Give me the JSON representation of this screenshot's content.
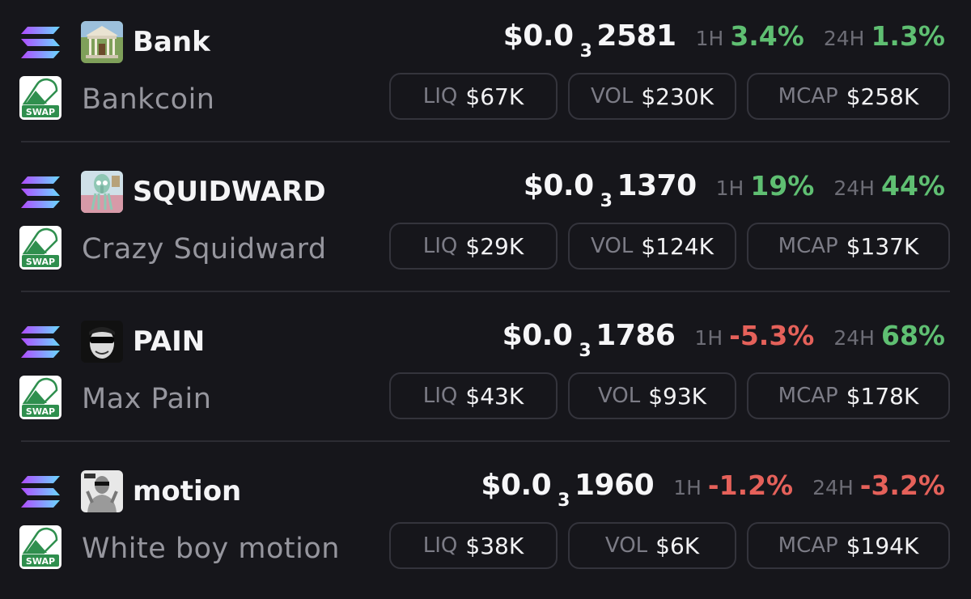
{
  "icons": {
    "chain": "solana-icon",
    "dex": "swap-icon",
    "dex_label": "SWAP"
  },
  "labels": {
    "h1": "1H",
    "h24": "24H",
    "liq": "LIQ",
    "vol": "VOL",
    "mcap": "MCAP"
  },
  "colors": {
    "background": "#16161b",
    "positive": "#5fbf72",
    "negative": "#e5615a",
    "muted": "#96969e"
  },
  "tokens": [
    {
      "symbol": "Bank",
      "name": "Bankcoin",
      "avatar": "bank-building-avatar",
      "price_prefix": "$0.0",
      "price_zeros": "3",
      "price_digits": "2581",
      "change_1h": "3.4%",
      "change_1h_dir": "pos",
      "change_24h": "1.3%",
      "change_24h_dir": "pos",
      "liq": "$67K",
      "vol": "$230K",
      "mcap": "$258K"
    },
    {
      "symbol": "SQUIDWARD",
      "name": "Crazy Squidward",
      "avatar": "squidward-avatar",
      "price_prefix": "$0.0",
      "price_zeros": "3",
      "price_digits": "1370",
      "change_1h": "19%",
      "change_1h_dir": "pos",
      "change_24h": "44%",
      "change_24h_dir": "pos",
      "liq": "$29K",
      "vol": "$124K",
      "mcap": "$137K"
    },
    {
      "symbol": "PAIN",
      "name": "Max Pain",
      "avatar": "pain-face-avatar",
      "price_prefix": "$0.0",
      "price_zeros": "3",
      "price_digits": "1786",
      "change_1h": "-5.3%",
      "change_1h_dir": "neg",
      "change_24h": "68%",
      "change_24h_dir": "pos",
      "liq": "$43K",
      "vol": "$93K",
      "mcap": "$178K"
    },
    {
      "symbol": "motion",
      "name": "White boy motion",
      "avatar": "motion-person-avatar",
      "price_prefix": "$0.0",
      "price_zeros": "3",
      "price_digits": "1960",
      "change_1h": "-1.2%",
      "change_1h_dir": "neg",
      "change_24h": "-3.2%",
      "change_24h_dir": "neg",
      "liq": "$38K",
      "vol": "$6K",
      "mcap": "$194K"
    }
  ]
}
